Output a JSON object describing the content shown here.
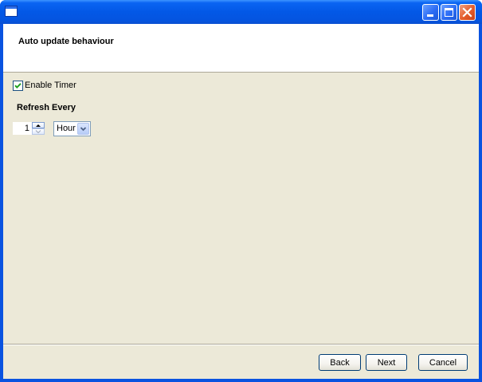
{
  "window": {
    "title": ""
  },
  "header": {
    "title": "Auto update behaviour"
  },
  "timer": {
    "enable_label": "Enable Timer",
    "enabled": true
  },
  "refresh": {
    "label": "Refresh Every",
    "interval_value": "1",
    "unit_selected": "Hour"
  },
  "footer": {
    "back_label": "Back",
    "next_label": "Next",
    "cancel_label": "Cancel"
  },
  "colors": {
    "titlebar": "#0358e6",
    "client_background": "#ece9d8",
    "header_background": "#ffffff",
    "checkmark": "#21a121",
    "close_button": "#e45c2b"
  }
}
